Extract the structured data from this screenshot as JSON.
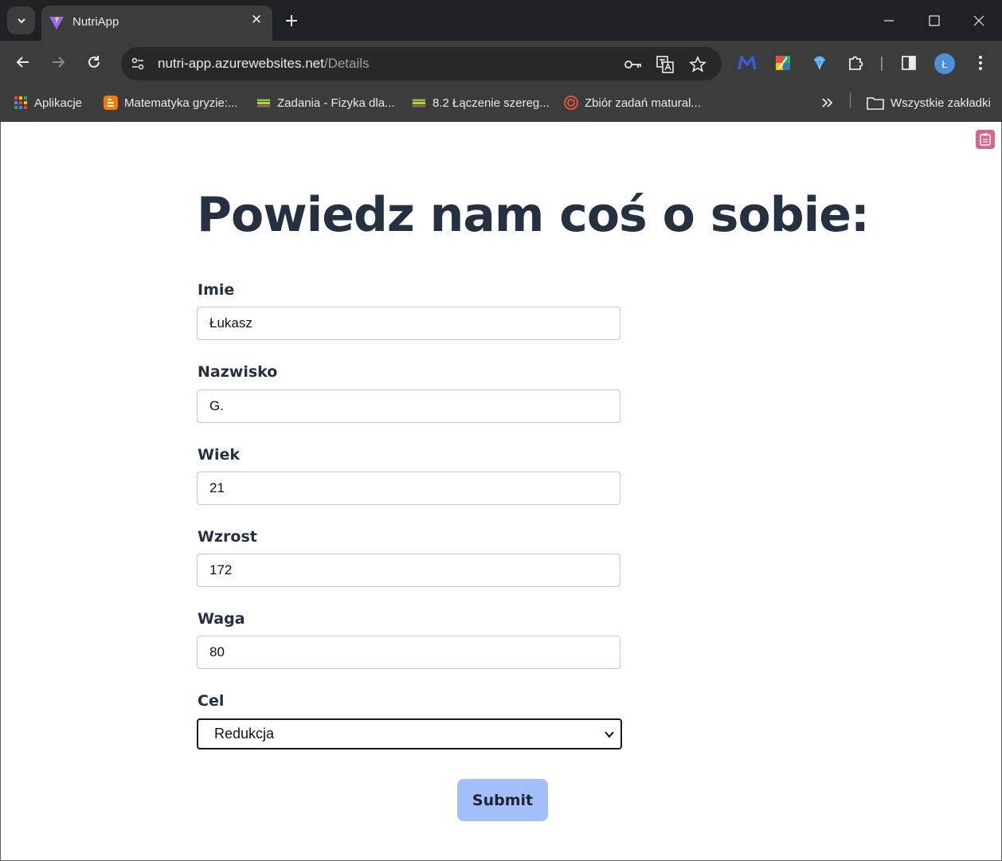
{
  "browser": {
    "tab": {
      "title": "NutriApp"
    },
    "address": {
      "host": "nutri-app.azurewebsites.net",
      "path": "/Details"
    },
    "profile_initial": "Ł",
    "bookmarks": [
      {
        "label": "Aplikacje",
        "icon": "apps-grid-icon"
      },
      {
        "label": "Matematyka gryzie:...",
        "icon": "blogger-icon"
      },
      {
        "label": "Zadania - Fizyka dla...",
        "icon": "book-icon"
      },
      {
        "label": "8.2 Łączenie szereg...",
        "icon": "book-icon"
      },
      {
        "label": "Zbiór zadań matural...",
        "icon": "target-icon"
      }
    ],
    "all_bookmarks": "Wszystkie zakładki"
  },
  "form": {
    "heading": "Powiedz nam coś o sobie:",
    "fields": [
      {
        "label": "Imie",
        "value": "Łukasz"
      },
      {
        "label": "Nazwisko",
        "value": "G."
      },
      {
        "label": "Wiek",
        "value": "21"
      },
      {
        "label": "Wzrost",
        "value": "172"
      },
      {
        "label": "Waga",
        "value": "80"
      }
    ],
    "goal": {
      "label": "Cel",
      "selected": "Redukcja"
    },
    "submit_label": "Submit"
  },
  "colors": {
    "heading": "#253040",
    "submit_bg": "#a3bffa",
    "chrome_dark": "#202124",
    "chrome_toolbar": "#3c3c3c"
  }
}
